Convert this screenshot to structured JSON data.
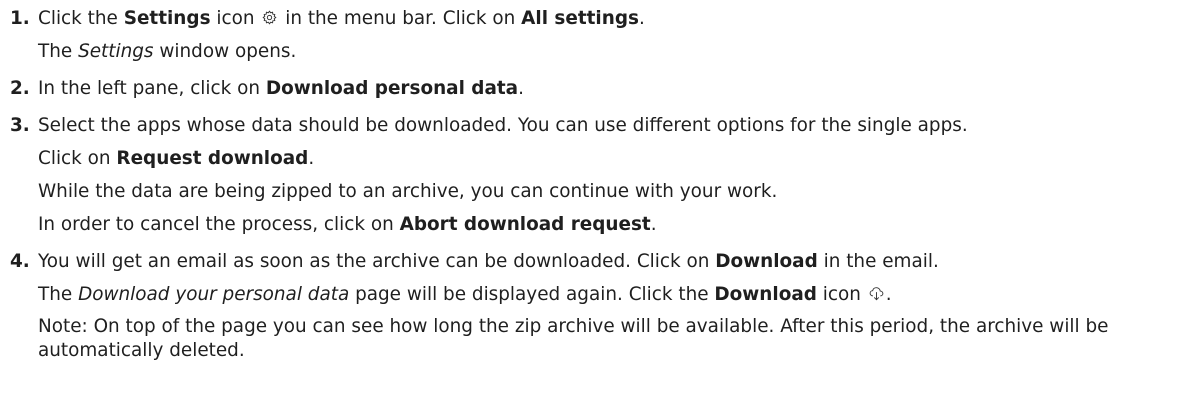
{
  "steps": [
    {
      "number": "1.",
      "line1": {
        "t1": "Click the ",
        "b1": "Settings",
        "t2": " icon",
        "t3": " in the menu bar. Click on ",
        "b2": "All settings",
        "t4": "."
      },
      "line2": {
        "t1": "The ",
        "i1": "Settings",
        "t2": " window opens."
      }
    },
    {
      "number": "2.",
      "line1": {
        "t1": "In the left pane, click on ",
        "b1": "Download personal data",
        "t2": "."
      }
    },
    {
      "number": "3.",
      "line1": "Select the apps whose data should be downloaded. You can use different options for the single apps.",
      "line2": {
        "t1": "Click on ",
        "b1": "Request download",
        "t2": "."
      },
      "line3": "While the data are being zipped to an archive, you can continue with your work.",
      "line4": {
        "t1": "In order to cancel the process, click on ",
        "b1": "Abort download request",
        "t2": "."
      }
    },
    {
      "number": "4.",
      "line1": {
        "t1": "You will get an email as soon as the archive can be downloaded. Click on ",
        "b1": "Download",
        "t2": " in the email."
      },
      "line2": {
        "t1": "The ",
        "i1": "Download your personal data",
        "t2": " page will be displayed again. Click the ",
        "b1": "Download",
        "t3": " icon",
        "t4": "."
      },
      "line3": "Note: On top of the page you can see how long the zip archive will be available. After this period, the archive will be automatically deleted."
    }
  ],
  "icons": {
    "settings": "gear-icon",
    "download": "download-icon"
  }
}
